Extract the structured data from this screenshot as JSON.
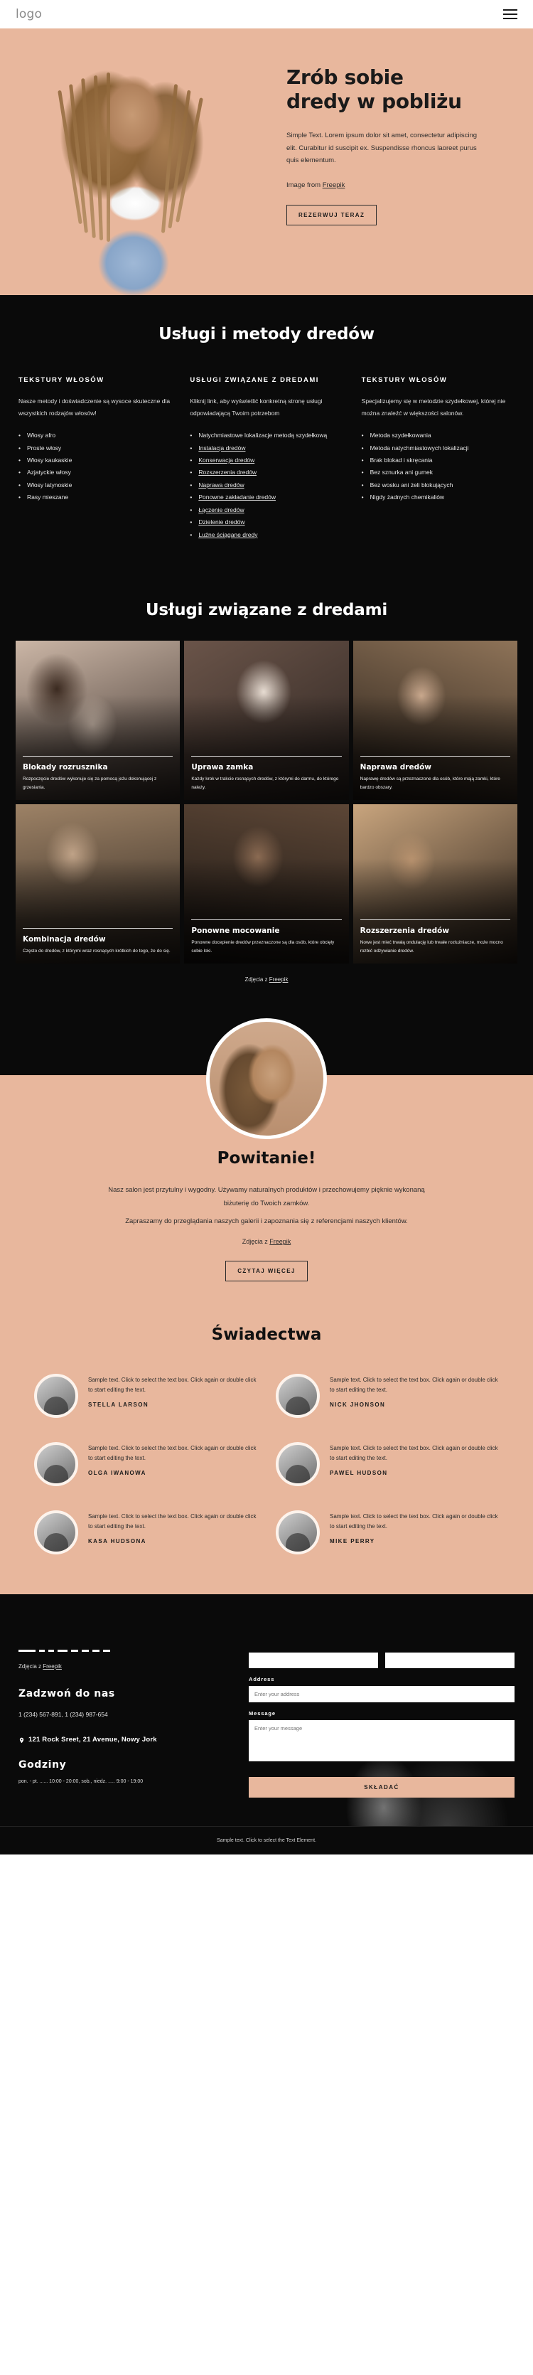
{
  "header": {
    "logo": "logo",
    "menu_icon": "hamburger-menu-icon"
  },
  "hero": {
    "title_line1": "Zrób sobie",
    "title_line2": "dredy w pobliżu",
    "paragraph": "Simple Text. Lorem ipsum dolor sit amet, consectetur adipiscing elit. Curabitur id suscipit ex. Suspendisse rhoncus laoreet purus quis elementum.",
    "credit_prefix": "Image from ",
    "credit_link": "Freepik",
    "cta": "REZERWUJ TERAZ"
  },
  "methods": {
    "title": "Usługi i metody dredów",
    "columns": [
      {
        "heading": "TEKSTURY WŁOSÓW",
        "paragraph": "Nasze metody i doświadczenie są wysoce skuteczne dla wszystkich rodzajów włosów!",
        "items": [
          {
            "label": "Włosy afro",
            "link": false
          },
          {
            "label": "Proste włosy",
            "link": false
          },
          {
            "label": "Włosy kaukaskie",
            "link": false
          },
          {
            "label": "Azjatyckie włosy",
            "link": false
          },
          {
            "label": "Włosy latynoskie",
            "link": false
          },
          {
            "label": "Rasy mieszane",
            "link": false
          }
        ]
      },
      {
        "heading": "USŁUGI ZWIĄZANE Z DREDAMI",
        "paragraph": "Kliknij link, aby wyświetlić konkretną stronę usługi odpowiadającą Twoim potrzebom",
        "items": [
          {
            "label": "Natychmiastowe lokalizacje metodą szydełkową",
            "link": false
          },
          {
            "label": "Instalacja dredów",
            "link": true
          },
          {
            "label": "Konserwacja dredów",
            "link": true
          },
          {
            "label": "Rozszerzenia dredów",
            "link": true
          },
          {
            "label": "Naprawa dredów",
            "link": true
          },
          {
            "label": "Ponowne zakładanie dredów",
            "link": true
          },
          {
            "label": "Łączenie dredów",
            "link": true
          },
          {
            "label": "Dzielenie dredów",
            "link": true
          },
          {
            "label": "Luźne ściągane dredy",
            "link": true
          }
        ]
      },
      {
        "heading": "TEKSTURY WŁOSÓW",
        "paragraph": "Specjalizujemy się w metodzie szydełkowej, której nie można znaleźć w większości salonów.",
        "items": [
          {
            "label": "Metoda szydełkowania",
            "link": false
          },
          {
            "label": "Metoda natychmiastowych lokalizacji",
            "link": false
          },
          {
            "label": "Brak blokad i skręcania",
            "link": false
          },
          {
            "label": "Bez sznurka ani gumek",
            "link": false
          },
          {
            "label": "Bez wosku ani żeli blokujących",
            "link": false
          },
          {
            "label": "Nigdy żadnych chemikaliów",
            "link": false
          }
        ]
      }
    ]
  },
  "services": {
    "title": "Usługi związane z dredami",
    "credit_prefix": "Zdjęcia z ",
    "credit_link": "Freepik",
    "cards": [
      {
        "title": "Blokady rozrusznika",
        "desc": "Rozpoczęcie dredów wykonuje się za pomocą jeżu dokonującej z grzesiania."
      },
      {
        "title": "Uprawa zamka",
        "desc": "Każdy krok w trakcie rosnących dredów, z którymi do darmu, do którego należy."
      },
      {
        "title": "Naprawa dredów",
        "desc": "Naprawę dredów są przeznaczone dla osób, które mają zamki, które bardzo obszary."
      },
      {
        "title": "Kombinacja dredów",
        "desc": "Często do dredów, z którymi wraz rosnących krótkich do tego, że do się."
      },
      {
        "title": "Ponowne mocowanie",
        "desc": "Ponowne docepienie dredów przeznaczone są dla osób, które obcięły sobie loki."
      },
      {
        "title": "Rozszerzenia dredów",
        "desc": "Nowe jest mieć trwałą ondulację lub trwałe rozluźniacze, może mocno rozbić odżywianie dredów."
      }
    ]
  },
  "welcome": {
    "title": "Powitanie!",
    "p1": "Nasz salon jest przytulny i wygodny. Używamy naturalnych produktów i przechowujemy pięknie wykonaną biżuterię do Twoich zamków.",
    "p2": "Zapraszamy do przeglądania naszych galerii i zapoznania się z referencjami naszych klientów.",
    "credit_prefix": "Zdjęcia z ",
    "credit_link": "Freepik",
    "cta": "CZYTAJ WIĘCEJ"
  },
  "testimonials": {
    "title": "Świadectwa",
    "items": [
      {
        "text": "Sample text. Click to select the text box. Click again or double click to start editing the text.",
        "name": "STELLA LARSON"
      },
      {
        "text": "Sample text. Click to select the text box. Click again or double click to start editing the text.",
        "name": "NICK JHONSON"
      },
      {
        "text": "Sample text. Click to select the text box. Click again or double click to start editing the text.",
        "name": "OLGA IWANOWA"
      },
      {
        "text": "Sample text. Click to select the text box. Click again or double click to start editing the text.",
        "name": "PAWEL HUDSON"
      },
      {
        "text": "Sample text. Click to select the text box. Click again or double click to start editing the text.",
        "name": "KASA HUDSONA"
      },
      {
        "text": "Sample text. Click to select the text box. Click again or double click to start editing the text.",
        "name": "MIKE PERRY"
      }
    ]
  },
  "footer": {
    "credit_prefix": "Zdjęcia z ",
    "credit_link": "Freepik",
    "call_title": "Zadzwoń do nas",
    "phones": "1 (234) 567-891, 1 (234) 987-654",
    "address": "121 Rock Sreet, 21 Avenue, Nowy Jork",
    "hours_title": "Godziny",
    "hours_line": "pon. - pt. ...... 10:00 - 20:00, sob., niedz. ..... 9:00 - 19:00",
    "form": {
      "address_label": "Address",
      "address_placeholder": "Enter your address",
      "message_label": "Message",
      "message_placeholder": "Enter your message",
      "submit": "SKŁADAĆ"
    }
  },
  "bottom_bar": {
    "text": "Sample text. Click to select the Text Element."
  },
  "colors": {
    "accent": "#e8b79d",
    "dark": "#0a0a0a",
    "text": "#1a1a1a"
  }
}
